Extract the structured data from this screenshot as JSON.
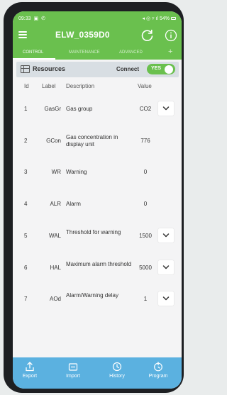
{
  "status_bar": {
    "time": "09:33",
    "icons_left": "▣ ✆",
    "icons_right": "◂ ◎ ▿ ıl",
    "battery": "54%"
  },
  "app_bar": {
    "title": "ELW_0359D0"
  },
  "tabs": [
    {
      "label": "CONTROL",
      "active": true
    },
    {
      "label": "MAINTENANCE",
      "active": false
    },
    {
      "label": "ADVANCED",
      "active": false
    }
  ],
  "tab_add": "+",
  "resources": {
    "title": "Resources",
    "connect_label": "Connect",
    "toggle_label": "YES",
    "connected": true
  },
  "table": {
    "headers": {
      "id": "Id",
      "label": "Label",
      "description": "Description",
      "value": "Value"
    },
    "rows": [
      {
        "id": "1",
        "label": "GasGr",
        "description": "Gas group",
        "value": "CO2",
        "dropdown": true
      },
      {
        "id": "2",
        "label": "GCon",
        "description": "Gas concentration in display unit",
        "value": "776",
        "dropdown": false
      },
      {
        "id": "3",
        "label": "WR",
        "description": "Warning",
        "value": "0",
        "dropdown": false
      },
      {
        "id": "4",
        "label": "ALR",
        "description": "Alarm",
        "value": "0",
        "dropdown": false
      },
      {
        "id": "5",
        "label": "WAL",
        "description": "Threshold for warning",
        "value": "1500",
        "dropdown": true
      },
      {
        "id": "6",
        "label": "HAL",
        "description": "Maximum alarm threshold",
        "value": "5000",
        "dropdown": true
      },
      {
        "id": "7",
        "label": "AOd",
        "description": "Alarm/Warning delay",
        "value": "1",
        "dropdown": true
      }
    ]
  },
  "bottom_bar": [
    {
      "label": "Export",
      "icon": "export-icon"
    },
    {
      "label": "Import",
      "icon": "import-icon"
    },
    {
      "label": "History",
      "icon": "history-icon"
    },
    {
      "label": "Program",
      "icon": "program-icon"
    }
  ],
  "colors": {
    "primary_green": "#6ac04e",
    "bottom_blue": "#5bb1e0",
    "header_gray": "#d8dee3"
  }
}
